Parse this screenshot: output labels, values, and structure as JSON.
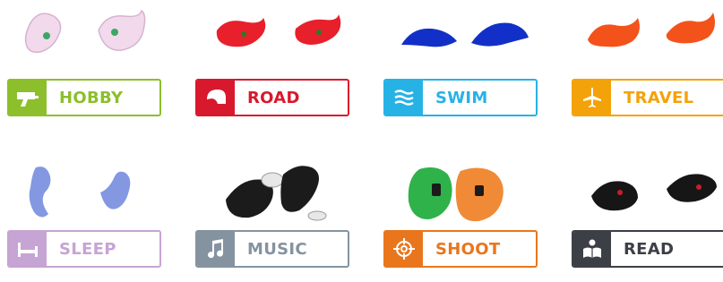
{
  "categories": [
    {
      "key": "hobby",
      "label": "HOBBY",
      "color": "#8cbf2b",
      "icon": "drill-icon",
      "plug_color": "#e9c7e0"
    },
    {
      "key": "road",
      "label": "ROAD",
      "color": "#d8192d",
      "icon": "helmet-icon",
      "plug_color": "#e7202b"
    },
    {
      "key": "swim",
      "label": "SWIM",
      "color": "#27b2e6",
      "icon": "waves-icon",
      "plug_color": "#1230c8"
    },
    {
      "key": "travel",
      "label": "TRAVEL",
      "color": "#f4a20a",
      "icon": "airplane-icon",
      "plug_color": "#f3531b"
    },
    {
      "key": "sleep",
      "label": "SLEEP",
      "color": "#c6a4d4",
      "icon": "bed-icon",
      "plug_color": "#8398e0"
    },
    {
      "key": "music",
      "label": "MUSIC",
      "color": "#8593a0",
      "icon": "music-note-icon",
      "plug_color": "#1b1b1b"
    },
    {
      "key": "shoot",
      "label": "SHOOT",
      "color": "#e9761c",
      "icon": "crosshair-icon",
      "plug_color": "#2fb24a"
    },
    {
      "key": "read",
      "label": "READ",
      "color": "#3c4046",
      "icon": "reader-icon",
      "plug_color": "#161616"
    }
  ]
}
